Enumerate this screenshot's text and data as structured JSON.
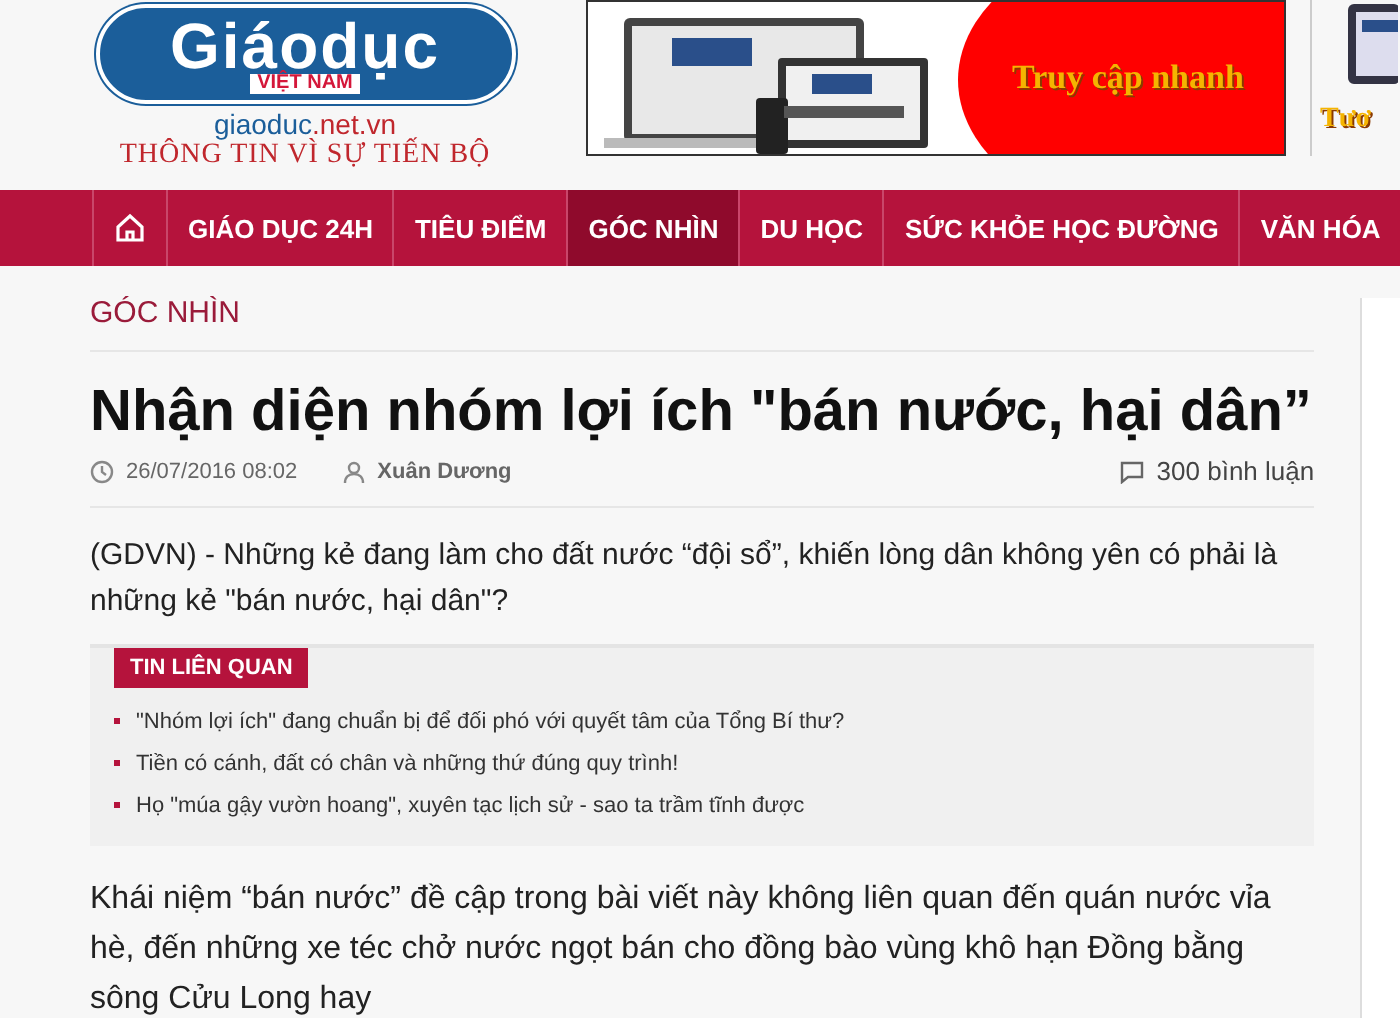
{
  "header": {
    "logo": {
      "brand": "Giáodục",
      "country": "VIỆT NAM",
      "domain_parts": [
        "giaoduc",
        ".net.vn"
      ],
      "slogan": "THÔNG TIN VÌ SỰ TIẾN BỘ"
    },
    "banners": [
      {
        "kind": "picture",
        "caption": "Truy cập nhanh"
      },
      {
        "kind": "picture",
        "caption": "Tươ"
      }
    ]
  },
  "nav": {
    "items": [
      {
        "kind": "home",
        "selected": false
      },
      {
        "kind": "text",
        "label": "GIÁO DỤC 24H",
        "selected": false
      },
      {
        "kind": "text",
        "label": "TIÊU ĐIỂM",
        "selected": false
      },
      {
        "kind": "text",
        "label": "GÓC NHÌN",
        "selected": true
      },
      {
        "kind": "text",
        "label": "DU HỌC",
        "selected": false
      },
      {
        "kind": "text",
        "label": "SỨC KHỎE HỌC ĐƯỜNG",
        "selected": false
      },
      {
        "kind": "text",
        "label": "VĂN HÓA",
        "selected": false
      }
    ]
  },
  "article": {
    "category": "GÓC NHÌN",
    "title": "Nhận diện nhóm lợi ích \"bán nước, hại dân”",
    "date": "26/07/2016 08:02",
    "author": "Xuân Dương",
    "comments": "300 bình luận",
    "lead": "(GDVN) - Những kẻ đang làm cho đất nước “đội sổ”, khiến lòng dân không yên có phải là những kẻ \"bán nước, hại dân\"?",
    "related": {
      "heading": "TIN LIÊN QUAN",
      "items": [
        "\"Nhóm lợi ích\" đang chuẩn bị để đối phó với quyết tâm của Tổng Bí thư?",
        "Tiền có cánh, đất có chân và những thứ đúng quy trình!",
        "Họ \"múa gậy vườn hoang\", xuyên tạc lịch sử - sao ta trầm tĩnh được"
      ]
    },
    "body": "Khái niệm “bán nước” đề cập trong bài viết này không liên quan đến quán nước vỉa hè, đến những xe téc chở nước ngọt bán cho đồng bào vùng khô hạn Đồng bằng sông Cửu Long hay"
  }
}
